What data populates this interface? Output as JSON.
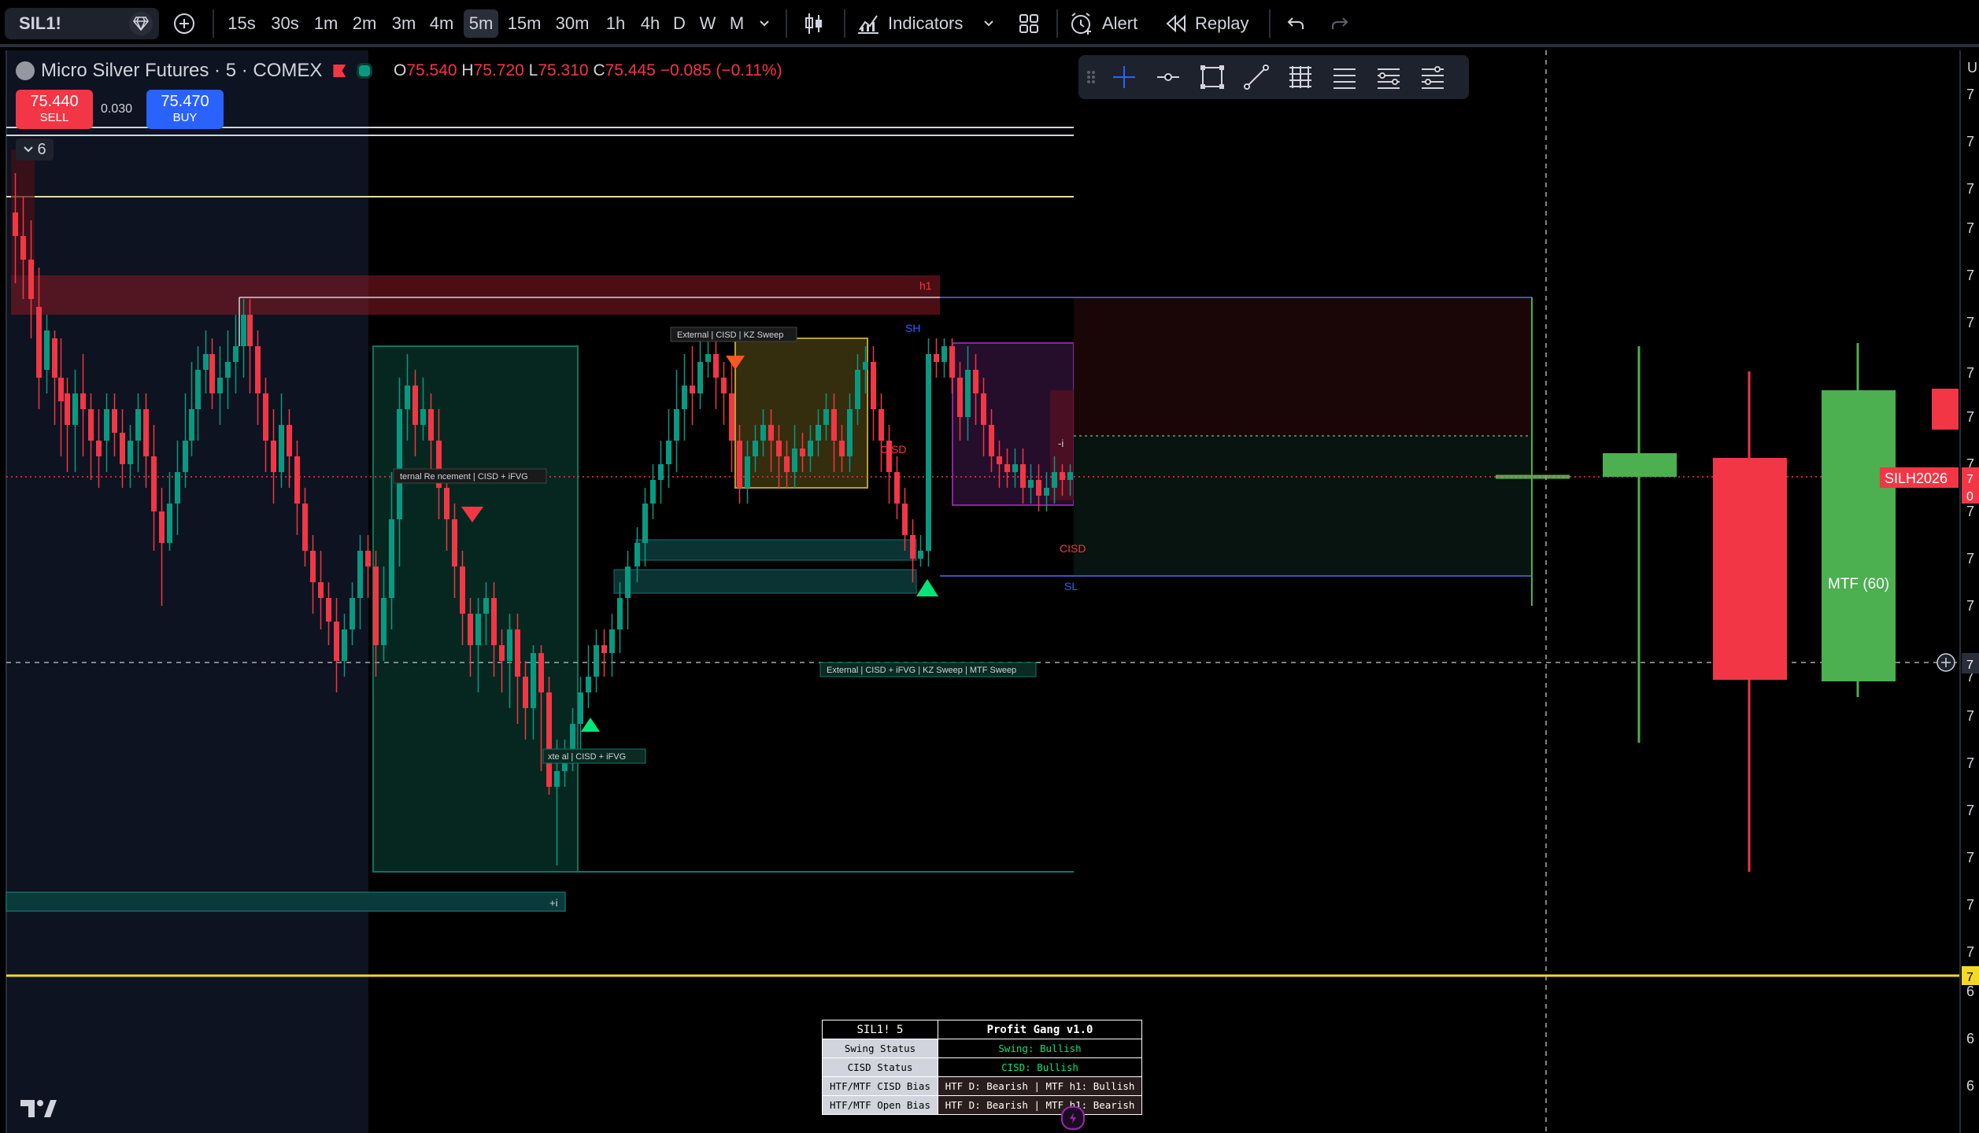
{
  "toolbar": {
    "symbol": "SIL1!",
    "timeframes": [
      "15s",
      "30s",
      "1m",
      "2m",
      "3m",
      "4m",
      "5m",
      "15m",
      "30m",
      "1h",
      "4h",
      "D",
      "W",
      "M"
    ],
    "active_timeframe": "5m",
    "indicators_label": "Indicators",
    "alert_label": "Alert",
    "replay_label": "Replay"
  },
  "legend": {
    "title": "Micro Silver Futures · 5 · COMEX",
    "o_key": "O",
    "o": "75.540",
    "h_key": "H",
    "h": "75.720",
    "l_key": "L",
    "l": "75.310",
    "c_key": "C",
    "c": "75.445",
    "change": "−0.085 (−0.11%)"
  },
  "trade": {
    "sell_price": "75.440",
    "sell_label": "SELL",
    "spread": "0.030",
    "buy_price": "75.470",
    "buy_label": "BUY"
  },
  "collapse_count": "6",
  "annotations": {
    "h1": "h1",
    "sh": "SH",
    "sl": "SL",
    "cisd_top": "CISD",
    "cisd_mid": "CISD",
    "minus_i": "-i",
    "plus_i": "+i",
    "label1": "External | CISD | KZ Sweep",
    "label2": "ternal Re  ncement | CISD + iFVG",
    "label3": "xte   al | CISD + iFVG",
    "label4": "External | CISD + iFVG | KZ Sweep | MTF Sweep",
    "mtf": "MTF (60)",
    "price_tag": "SILH2026"
  },
  "scale": {
    "top_label": "U",
    "digits": [
      "7",
      "7",
      "7",
      "7",
      "7",
      "7",
      "7",
      "7",
      "7",
      "7",
      "7",
      "7",
      "7",
      "7",
      "7",
      "7",
      "7",
      "7",
      "7",
      "6",
      "6",
      "6"
    ],
    "tag1": "7",
    "tag1b": "0",
    "tag2": "7",
    "tag3": "7"
  },
  "status_table": {
    "header_left": "SIL1! 5",
    "header_right": "Profit Gang v1.0",
    "rows": [
      {
        "label": "Swing Status",
        "value": "Swing: Bullish"
      },
      {
        "label": "CISD Status",
        "value": "CISD: Bullish"
      },
      {
        "label": "HTF/MTF CISD Bias",
        "value": "HTF D: Bearish  |  MTF h1: Bullish"
      },
      {
        "label": "HTF/MTF Open Bias",
        "value": "HTF D: Bearish  |  MTF h1: Bearish"
      }
    ]
  },
  "colors": {
    "bull": "#089981",
    "bear": "#f23645",
    "bull_big": "#4caf50",
    "yellow": "#f5d823",
    "blue": "#2962ff"
  }
}
